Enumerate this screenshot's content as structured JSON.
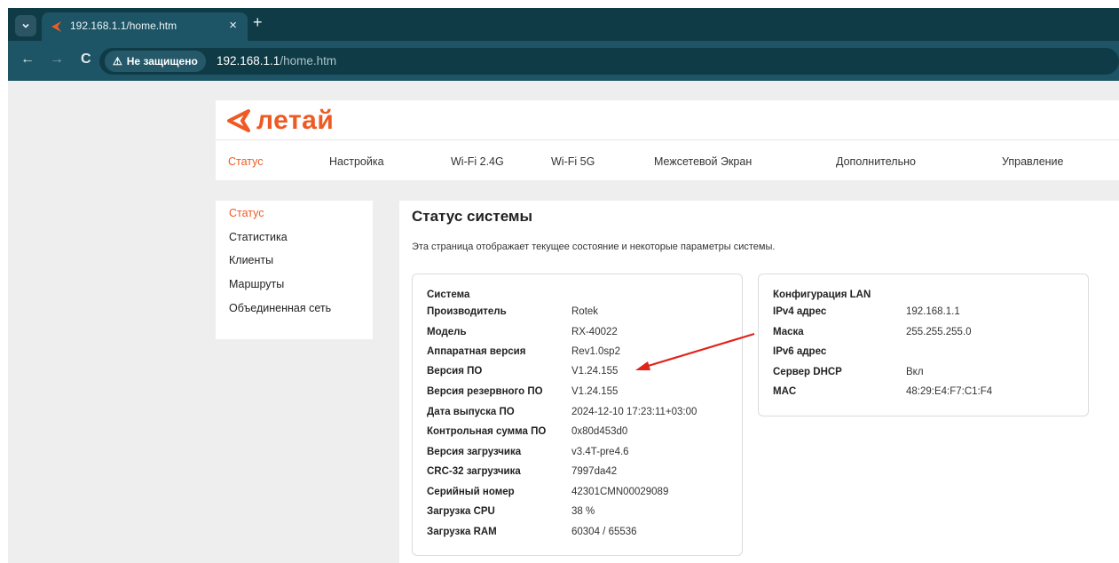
{
  "browser": {
    "tab_title": "192.168.1.1/home.htm",
    "tab_close": "×",
    "new_tab": "+",
    "menu_icon": "chevron-down-icon",
    "back": "←",
    "forward": "→",
    "reload": "C",
    "security_icon": "⚠",
    "security_label": "Не защищено",
    "url_host": "192.168.1.1",
    "url_path": "/home.htm",
    "accent": "#0f3b47"
  },
  "brand": {
    "logo_text": "летай",
    "color": "#ee5a24"
  },
  "topnav": [
    {
      "label": "Статус",
      "active": true
    },
    {
      "label": "Настройка"
    },
    {
      "label": "Wi-Fi 2.4G"
    },
    {
      "label": "Wi-Fi 5G"
    },
    {
      "label": "Межсетевой Экран"
    },
    {
      "label": "Дополнительно"
    },
    {
      "label": "Управление"
    }
  ],
  "sidebar": [
    {
      "label": "Статус",
      "active": true
    },
    {
      "label": "Статистика"
    },
    {
      "label": "Клиенты"
    },
    {
      "label": "Маршруты"
    },
    {
      "label": "Объединенная сеть"
    }
  ],
  "main": {
    "title": "Статус системы",
    "description": "Эта страница отображает текущее состояние и некоторые параметры системы."
  },
  "system": {
    "heading": "Система",
    "rows": [
      {
        "label": "Производитель",
        "value": "Rotek"
      },
      {
        "label": "Модель",
        "value": "RX-40022"
      },
      {
        "label": "Аппаратная версия",
        "value": "Rev1.0sp2"
      },
      {
        "label": "Версия ПО",
        "value": "V1.24.155"
      },
      {
        "label": "Версия резервного ПО",
        "value": "V1.24.155"
      },
      {
        "label": "Дата выпуска ПО",
        "value": "2024-12-10 17:23:11+03:00"
      },
      {
        "label": "Контрольная сумма ПО",
        "value": "0x80d453d0"
      },
      {
        "label": "Версия загрузчика",
        "value": "v3.4T-pre4.6"
      },
      {
        "label": "CRC-32 загрузчика",
        "value": "7997da42"
      },
      {
        "label": "Серийный номер",
        "value": "42301CMN00029089"
      },
      {
        "label": "Загрузка CPU",
        "value": "38 %"
      },
      {
        "label": "Загрузка RAM",
        "value": "60304 / 65536"
      }
    ]
  },
  "lan": {
    "heading": "Конфигурация LAN",
    "rows": [
      {
        "label": "IPv4 адрес",
        "value": "192.168.1.1"
      },
      {
        "label": "Маска",
        "value": "255.255.255.0"
      },
      {
        "label": "IPv6 адрес",
        "value": ""
      },
      {
        "label": "Сервер DHCP",
        "value": "Вкл"
      },
      {
        "label": "MAC",
        "value": "48:29:E4:F7:C1:F4"
      }
    ]
  },
  "annotation": {
    "arrow_color": "#e0241b"
  }
}
